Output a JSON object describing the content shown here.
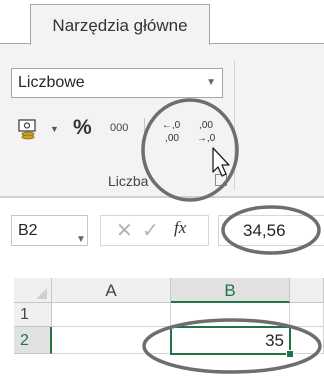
{
  "ribbon": {
    "active_tab": "Narzędzia główne",
    "number_format": "Liczbowe",
    "comma_style": "000",
    "increase_decimal": "←,0\n,00",
    "decrease_decimal": ",00\n→,0",
    "group_label": "Liczba"
  },
  "formula_bar": {
    "name_box": "B2",
    "cancel_symbol": "✕",
    "enter_symbol": "✓",
    "fx_symbol": "fx",
    "value": "34,56"
  },
  "grid": {
    "columns": [
      "A",
      "B"
    ],
    "rows": [
      "1",
      "2"
    ],
    "active_cell_display": "35"
  },
  "icons": {
    "currency": "accounting-number-format-icon",
    "percent": "%",
    "cursor": "mouse-pointer-icon"
  },
  "colors": {
    "selection_green": "#217346",
    "annotation_gray": "#6e6e6e"
  }
}
